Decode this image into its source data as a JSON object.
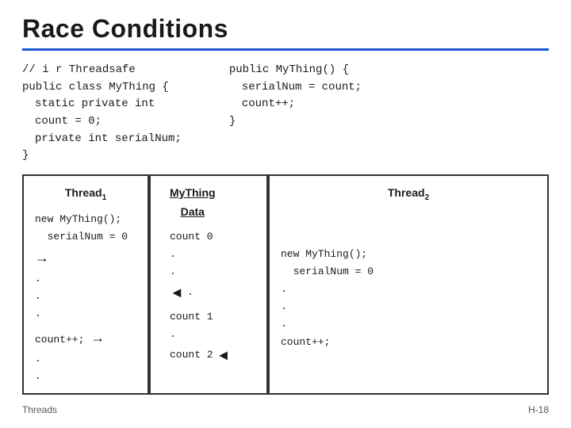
{
  "title": "Race Conditions",
  "code_block": {
    "left_lines": [
      "// i r Threadsafe",
      "public class MyThing {",
      "  static private int",
      "  count = 0;",
      "  private int serialNum;",
      "}"
    ],
    "right_lines": [
      "public MyThing() {",
      "    serialNum = count;",
      "    count++;",
      "}"
    ]
  },
  "diagram": {
    "thread1": {
      "header": "Thread",
      "header_sub": "1",
      "lines": [
        "new MyThing();",
        "  serialNum = 0",
        ".",
        ".",
        ".",
        "count++;",
        ".",
        "."
      ]
    },
    "middle": {
      "header": "MyThing",
      "header2": "Data",
      "lines": [
        "count 0",
        ".",
        ".",
        ".",
        "count 1",
        ".",
        "count 2"
      ]
    },
    "thread2": {
      "header": "Thread",
      "header_sub": "2",
      "lines": [
        "",
        "",
        "new MyThing();",
        "  serialNum = 0",
        ".",
        ".",
        ".",
        "count++;"
      ]
    }
  },
  "footer": {
    "left": "Threads",
    "right": "H-18"
  },
  "arrows": [
    {
      "type": "right",
      "label": "arrow-t1-to-middle-1"
    },
    {
      "type": "left",
      "label": "arrow-middle-to-t2-1"
    },
    {
      "type": "right",
      "label": "arrow-t1-to-middle-2"
    },
    {
      "type": "left",
      "label": "arrow-middle-to-t2-2"
    }
  ]
}
